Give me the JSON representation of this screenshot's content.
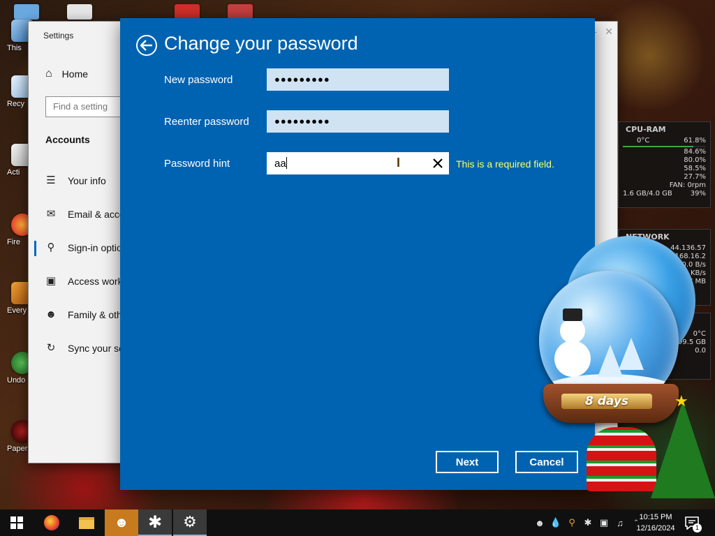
{
  "desktop": {
    "icons": [
      {
        "label": "This"
      },
      {
        "label": "Recy"
      },
      {
        "label": "Acti"
      },
      {
        "label": "Fire"
      },
      {
        "label": "Every"
      },
      {
        "label": "Undo"
      },
      {
        "label": "Papers, P"
      }
    ]
  },
  "settings": {
    "title": "Settings",
    "home": "Home",
    "search_placeholder": "Find a setting",
    "section": "Accounts",
    "nav": [
      {
        "label": "Your info",
        "icon": "person-info-icon"
      },
      {
        "label": "Email & acco",
        "icon": "mail-icon"
      },
      {
        "label": "Sign-in optio",
        "icon": "key-icon",
        "selected": true
      },
      {
        "label": "Access work",
        "icon": "briefcase-icon"
      },
      {
        "label": "Family & oth",
        "icon": "person-add-icon"
      },
      {
        "label": "Sync your se",
        "icon": "sync-icon"
      }
    ]
  },
  "dialog": {
    "title": "Change your password",
    "new_password_label": "New password",
    "new_password_value": "●●●●●●●●●",
    "reenter_label": "Reenter password",
    "reenter_value": "●●●●●●●●●",
    "hint_label": "Password hint",
    "hint_value": "aa",
    "error": "This is a required field.",
    "next": "Next",
    "cancel": "Cancel",
    "accent": "#0063b1",
    "error_color": "#ffff66"
  },
  "gadgets": {
    "cpu_ram": {
      "title": "CPU-RAM",
      "temp": "0°C",
      "total": "61.8%",
      "cores": [
        "84.6%",
        "80.0%",
        "58.5%",
        "27.7%"
      ],
      "core_levels": [
        0.846,
        0.8,
        0.585,
        0.277
      ],
      "fan": "FAN: 0rpm",
      "ram": "1.6 GB/4.0 GB",
      "ram_pct": "39%"
    },
    "network": {
      "title": "NETWORK",
      "lines": [
        "44.136.57",
        "168.16.2",
        "0.0 B/s",
        "KB/s",
        "7 MB"
      ]
    },
    "drive": {
      "lines": [
        "0°C",
        "99.5 GB",
        "0.0"
      ]
    }
  },
  "countdown": {
    "label": "8 days"
  },
  "taskbar": {
    "apps": [
      {
        "name": "start",
        "icon": "windows-icon"
      },
      {
        "name": "firefox",
        "icon": "firefox-icon"
      },
      {
        "name": "file-explorer",
        "icon": "folder-icon"
      },
      {
        "name": "app-people",
        "icon": "people-icon"
      },
      {
        "name": "app-asterisk",
        "icon": "asterisk-icon"
      },
      {
        "name": "settings",
        "icon": "gear-icon"
      }
    ],
    "time": "10:15 PM",
    "date": "12/16/2024",
    "notifications": "1"
  }
}
